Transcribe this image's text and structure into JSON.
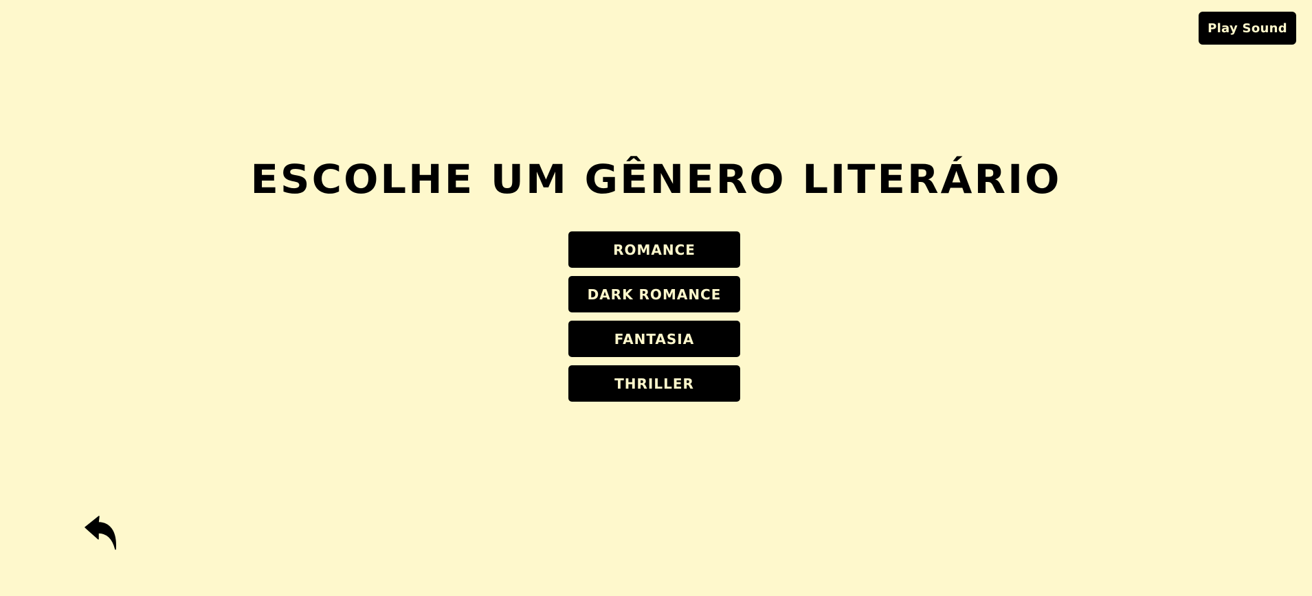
{
  "header": {
    "play_sound_label": "Play Sound"
  },
  "main": {
    "title": "ESCOLHE UM GÊNERO LITERÁRIO",
    "genres": [
      {
        "label": "ROMANCE"
      },
      {
        "label": "DARK ROMANCE"
      },
      {
        "label": "FANTASIA"
      },
      {
        "label": "THRILLER"
      }
    ]
  },
  "footer": {
    "back_icon": "reply-arrow-icon"
  },
  "colors": {
    "background": "#fef8cc",
    "button": "#000000",
    "button_text": "#fef8cc"
  }
}
